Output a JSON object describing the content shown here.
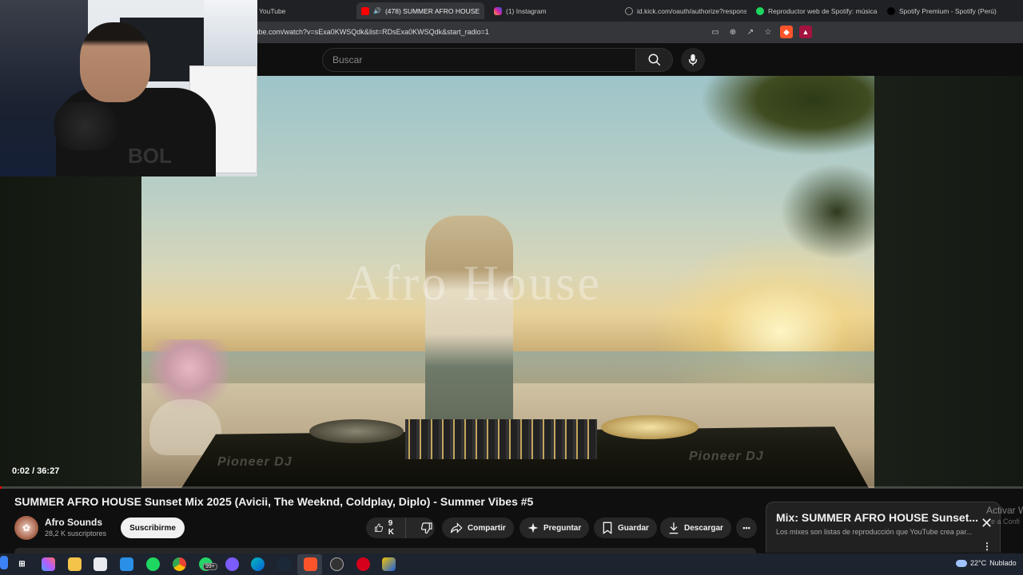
{
  "browser": {
    "tabs": [
      {
        "title": "YouTube"
      },
      {
        "title": "(478) SUMMER AFRO HOUSE",
        "close": "×"
      },
      {
        "title": "(1) Instagram"
      },
      {
        "title": "id.kick.com/oauth/authorize?respons"
      },
      {
        "title": "Reproductor web de Spotify: música"
      },
      {
        "title": "Spotify Premium - Spotify (Perú)"
      }
    ],
    "url": "tube.com/watch?v=sExa0KWSQdk&list=RDsExa0KWSQdk&start_radio=1"
  },
  "search": {
    "placeholder": "Buscar"
  },
  "player": {
    "watermark": "Afro House",
    "brand_left": "Pioneer DJ",
    "brand_right": "Pioneer DJ",
    "time": "0:02 / 36:27",
    "progress_fraction": 0.001
  },
  "video": {
    "title": "SUMMER AFRO HOUSE Sunset Mix 2025 (Avicii, The Weeknd, Coldplay, Diplo) - Summer Vibes #5",
    "channel": "Afro Sounds",
    "subscribers": "28,2 K suscriptores",
    "subscribe_label": "Suscribirme",
    "likes": "9 K",
    "share_label": "Compartir",
    "ask_label": "Preguntar",
    "save_label": "Guardar",
    "download_label": "Descargar",
    "more": "•••"
  },
  "mix": {
    "title": "Mix: SUMMER AFRO HOUSE Sunset...",
    "description": "Los mixes son listas de reproducción que YouTube crea par...",
    "close": "✕",
    "menu": "⋮"
  },
  "overlay": {
    "activate": "Activar W",
    "activate_sub": "e a Confi"
  },
  "webcam": {
    "shirt_text": "BOL"
  },
  "taskbar": {
    "badge": "99+",
    "temperature": "22°C",
    "weather": "Nublado"
  },
  "colors": {
    "youtube_red": "#ff0000",
    "background": "#0f0f0f",
    "pill": "#272727",
    "spotify_green": "#1ed760"
  },
  "icons": [
    "search-icon",
    "mic-icon",
    "like-icon",
    "dislike-icon",
    "share-icon",
    "sparkle-icon",
    "save-icon",
    "download-icon",
    "close-icon"
  ]
}
